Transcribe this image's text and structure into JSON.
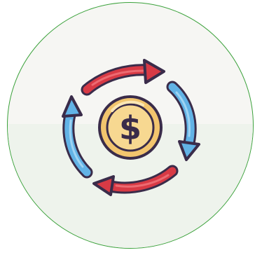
{
  "icon": {
    "name": "money-exchange-icon",
    "coin_symbol": "$"
  },
  "colors": {
    "ring": "#3aa13a",
    "badge_fill": "#f6f6f3",
    "badge_lower": "#eef3ec",
    "arrow_red": "#d83a45",
    "arrow_red_highlight": "#ec6b72",
    "arrow_blue": "#62b3e6",
    "arrow_blue_highlight": "#9fd4f3",
    "coin": "#f2c56e",
    "coin_inner": "#f7d891",
    "outline": "#3a2c4a"
  }
}
